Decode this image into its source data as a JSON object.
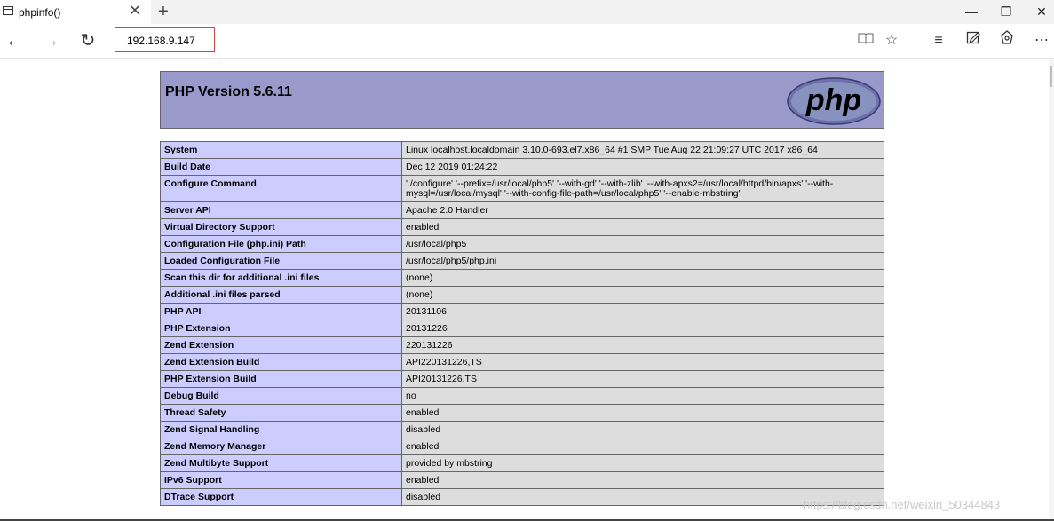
{
  "browser": {
    "tab": {
      "title": "phpinfo()",
      "icon": "page-icon",
      "close_glyph": "✕"
    },
    "new_tab_glyph": "+",
    "window": {
      "minimize": "—",
      "restore": "❐",
      "close": "✕"
    },
    "nav": {
      "back": "←",
      "forward": "→",
      "refresh": "↻"
    },
    "address": "192.168.9.147",
    "tools": {
      "reading_view": "📖",
      "favorite": "☆",
      "hub": "≡",
      "notes": "✎",
      "share": "⇪",
      "more": "⋯"
    }
  },
  "php": {
    "heading": "PHP Version 5.6.11",
    "logo_text": "php",
    "rows": [
      {
        "key": "System",
        "value": "Linux localhost.localdomain 3.10.0-693.el7.x86_64 #1 SMP Tue Aug 22 21:09:27 UTC 2017 x86_64"
      },
      {
        "key": "Build Date",
        "value": "Dec 12 2019 01:24:22"
      },
      {
        "key": "Configure Command",
        "value": "'./configure' '--prefix=/usr/local/php5' '--with-gd' '--with-zlib' '--with-apxs2=/usr/local/httpd/bin/apxs' '--with-mysql=/usr/local/mysql' '--with-config-file-path=/usr/local/php5' '--enable-mbstring'"
      },
      {
        "key": "Server API",
        "value": "Apache 2.0 Handler"
      },
      {
        "key": "Virtual Directory Support",
        "value": "enabled"
      },
      {
        "key": "Configuration File (php.ini) Path",
        "value": "/usr/local/php5"
      },
      {
        "key": "Loaded Configuration File",
        "value": "/usr/local/php5/php.ini"
      },
      {
        "key": "Scan this dir for additional .ini files",
        "value": "(none)"
      },
      {
        "key": "Additional .ini files parsed",
        "value": "(none)"
      },
      {
        "key": "PHP API",
        "value": "20131106"
      },
      {
        "key": "PHP Extension",
        "value": "20131226"
      },
      {
        "key": "Zend Extension",
        "value": "220131226"
      },
      {
        "key": "Zend Extension Build",
        "value": "API220131226,TS"
      },
      {
        "key": "PHP Extension Build",
        "value": "API20131226,TS"
      },
      {
        "key": "Debug Build",
        "value": "no"
      },
      {
        "key": "Thread Safety",
        "value": "enabled"
      },
      {
        "key": "Zend Signal Handling",
        "value": "disabled"
      },
      {
        "key": "Zend Memory Manager",
        "value": "enabled"
      },
      {
        "key": "Zend Multibyte Support",
        "value": "provided by mbstring"
      },
      {
        "key": "IPv6 Support",
        "value": "enabled"
      },
      {
        "key": "DTrace Support",
        "value": "disabled"
      }
    ]
  },
  "watermark": "https://blog.csdn.net/weixin_50344843",
  "colors": {
    "header_bg": "#9999cc",
    "key_bg": "#ccccff",
    "value_bg": "#dddddd",
    "address_border": "#e0403a"
  }
}
